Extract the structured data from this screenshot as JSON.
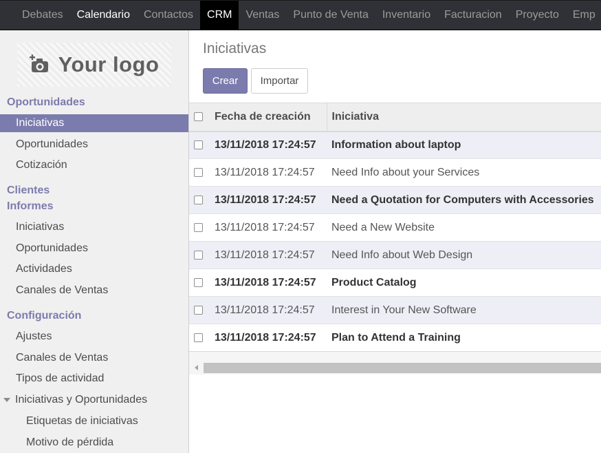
{
  "navbar": {
    "items": [
      {
        "label": "Debates"
      },
      {
        "label": "Calendario"
      },
      {
        "label": "Contactos"
      },
      {
        "label": "CRM"
      },
      {
        "label": "Ventas"
      },
      {
        "label": "Punto de Venta"
      },
      {
        "label": "Inventario"
      },
      {
        "label": "Facturacion"
      },
      {
        "label": "Proyecto"
      },
      {
        "label": "Emp"
      }
    ],
    "active": "CRM"
  },
  "sidebar": {
    "logo_text": "Your logo",
    "sections": {
      "oportunidades": "Oportunidades",
      "clientes": "Clientes",
      "informes": "Informes",
      "configuracion": "Configuración"
    },
    "items": {
      "iniciativas": "Iniciativas",
      "oportunidades": "Oportunidades",
      "cotizacion": "Cotización",
      "inf_iniciativas": "Iniciativas",
      "inf_oportunidades": "Oportunidades",
      "inf_actividades": "Actividades",
      "inf_canales": "Canales de Ventas",
      "cfg_ajustes": "Ajustes",
      "cfg_canales": "Canales de Ventas",
      "cfg_tipos": "Tipos de actividad",
      "cfg_iniciativas_oportunidades": "Iniciativas y Oportunidades",
      "cfg_etiquetas": "Etiquetas de iniciativas",
      "cfg_motivo": "Motivo de pérdida"
    }
  },
  "main": {
    "breadcrumb": "Iniciativas",
    "buttons": {
      "create": "Crear",
      "import": "Importar"
    },
    "table": {
      "headers": {
        "date": "Fecha de creación",
        "lead": "Iniciativa"
      },
      "rows": [
        {
          "date": "13/11/2018 17:24:57",
          "lead": "Information about laptop",
          "bold": true
        },
        {
          "date": "13/11/2018 17:24:57",
          "lead": "Need Info about your Services",
          "bold": false
        },
        {
          "date": "13/11/2018 17:24:57",
          "lead": "Need a Quotation for Computers with Accessories",
          "bold": true
        },
        {
          "date": "13/11/2018 17:24:57",
          "lead": "Need a New Website",
          "bold": false
        },
        {
          "date": "13/11/2018 17:24:57",
          "lead": "Need Info about Web Design",
          "bold": false
        },
        {
          "date": "13/11/2018 17:24:57",
          "lead": "Product Catalog",
          "bold": true
        },
        {
          "date": "13/11/2018 17:24:57",
          "lead": "Interest in Your New Software",
          "bold": false
        },
        {
          "date": "13/11/2018 17:24:57",
          "lead": "Plan to Attend a Training",
          "bold": true
        }
      ]
    }
  },
  "colors": {
    "accent": "#7c7bad",
    "navbar_bg": "#2f3136",
    "sidebar_bg": "#f0f0f0",
    "row_shaded": "#eeeef6"
  }
}
